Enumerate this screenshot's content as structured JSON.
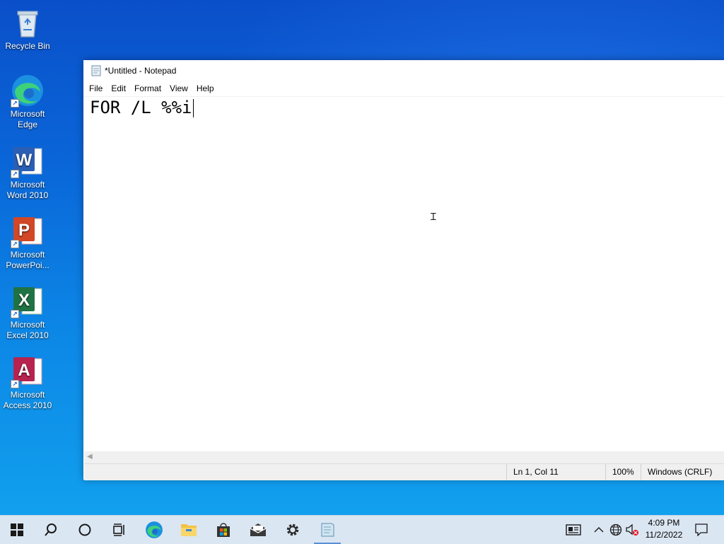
{
  "desktop": {
    "icons": [
      {
        "label": "Recycle Bin"
      },
      {
        "label": "Microsoft Edge"
      },
      {
        "label": "Microsoft Word 2010"
      },
      {
        "label": "Microsoft PowerPoi..."
      },
      {
        "label": "Microsoft Excel 2010"
      },
      {
        "label": "Microsoft Access 2010"
      }
    ]
  },
  "notepad": {
    "title": "*Untitled - Notepad",
    "menu": [
      "File",
      "Edit",
      "Format",
      "View",
      "Help"
    ],
    "content": "FOR /L %%i",
    "status": {
      "position": "Ln 1, Col 11",
      "zoom": "100%",
      "line_ending": "Windows (CRLF)"
    }
  },
  "taskbar": {
    "clock_time": "4:09 PM",
    "clock_date": "11/2/2022",
    "accent": "#5a8fd6"
  }
}
